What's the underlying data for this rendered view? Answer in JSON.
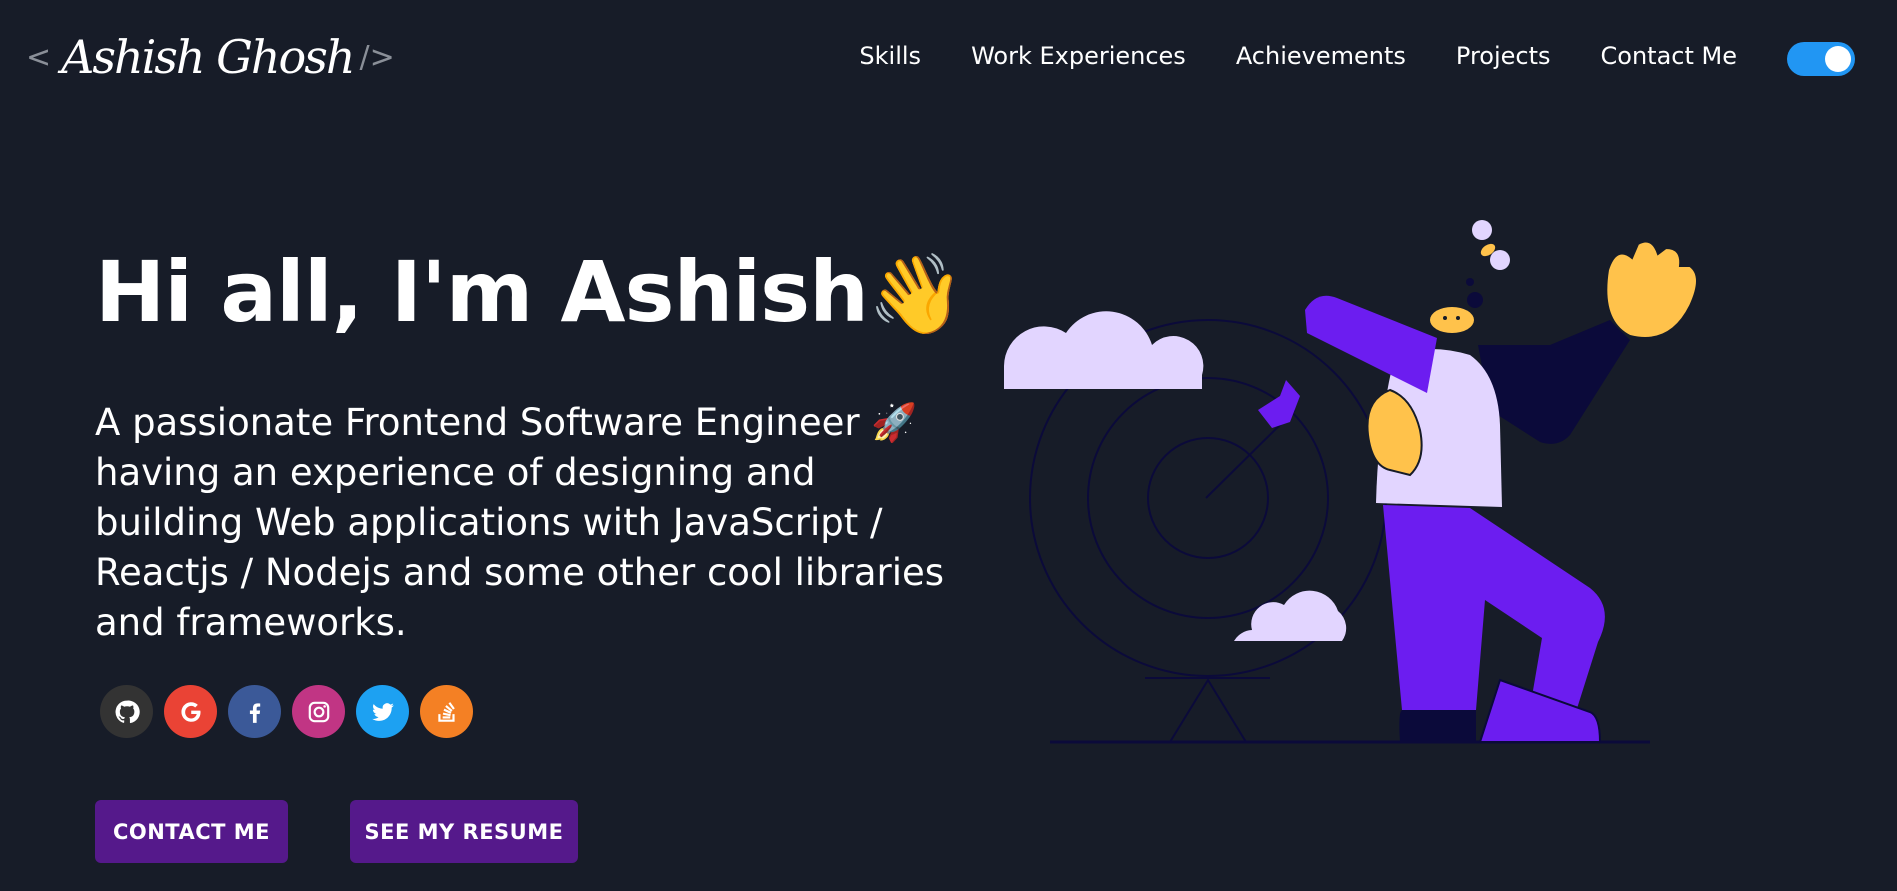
{
  "header": {
    "logo": {
      "open": "<",
      "name": "Ashish Ghosh",
      "close": "/>"
    },
    "nav": [
      "Skills",
      "Work Experiences",
      "Achievements",
      "Projects",
      "Contact Me"
    ],
    "theme_toggle_on": true
  },
  "hero": {
    "title": "Hi all, I'm Ashish",
    "wave_emoji": "👋",
    "subtitle": "A passionate Frontend Software Engineer 🚀 having an experience of designing and building Web applications with JavaScript / Reactjs / Nodejs and some other cool libraries and frameworks."
  },
  "socials": [
    {
      "icon": "github-icon",
      "color": "#333333"
    },
    {
      "icon": "google-icon",
      "color": "#ea4335"
    },
    {
      "icon": "facebook-icon",
      "color": "#3b5998"
    },
    {
      "icon": "instagram-icon",
      "color": "#c13584"
    },
    {
      "icon": "twitter-icon",
      "color": "#1da1f2"
    },
    {
      "icon": "stack-overflow-icon",
      "color": "#f48024"
    }
  ],
  "buttons": {
    "contact": "CONTACT ME",
    "resume": "SEE MY RESUME"
  },
  "colors": {
    "background": "#171c28",
    "button": "#55198b",
    "toggle": "#2196f3",
    "accent_purple": "#6c1df0"
  }
}
